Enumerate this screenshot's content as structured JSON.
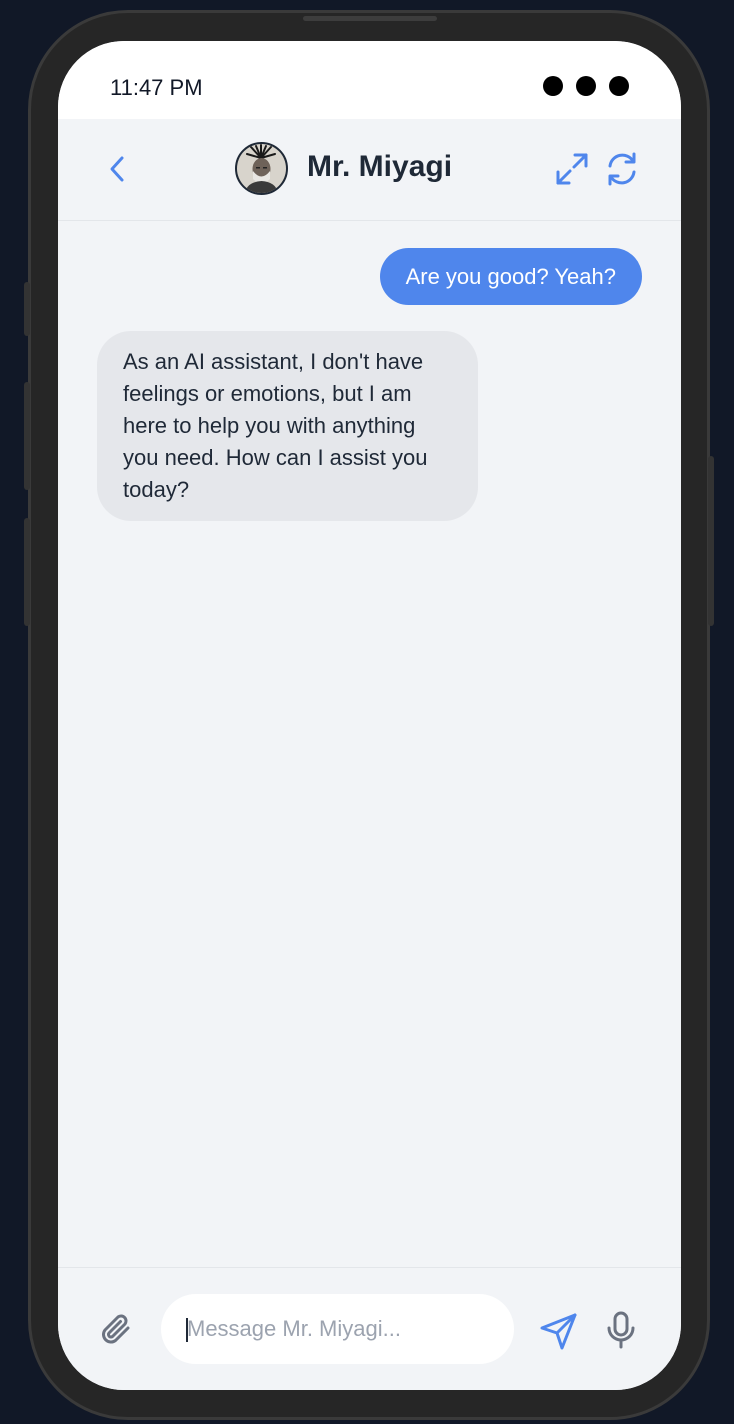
{
  "status_bar": {
    "time": "11:47 PM"
  },
  "header": {
    "contact_name": "Mr. Miyagi",
    "back_icon": "chevron-left-icon",
    "expand_icon": "expand-icon",
    "refresh_icon": "refresh-icon"
  },
  "messages": [
    {
      "sender": "user",
      "text": "Are you good? Yeah?"
    },
    {
      "sender": "assistant",
      "text": "As an AI assistant, I don't have feelings or emotions, but I am here to help you with anything you need. How can I assist you today?"
    }
  ],
  "composer": {
    "placeholder": "Message Mr. Miyagi...",
    "value": "",
    "attach_icon": "paperclip-icon",
    "send_icon": "send-icon",
    "mic_icon": "microphone-icon"
  },
  "colors": {
    "accent": "#4f86ec",
    "user_bubble": "#4f86ec",
    "assistant_bubble": "#e5e7eb",
    "screen_background": "#f2f4f7",
    "page_background": "#111827"
  }
}
